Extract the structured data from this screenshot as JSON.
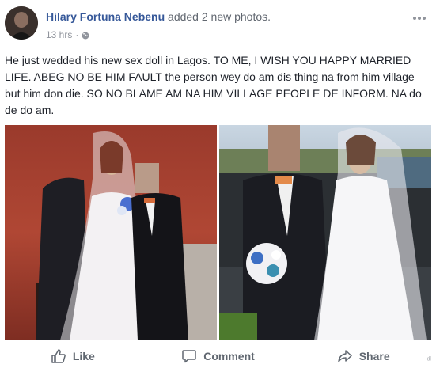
{
  "post": {
    "author": "Hilary Fortuna Nebenu",
    "action": "added 2 new photos.",
    "time": "13 hrs",
    "separator": "·",
    "more_icon": "ellipsis-icon",
    "privacy_icon": "globe-icon",
    "text": "He just wedded his new sex doll in Lagos. TO ME, I WISH YOU HAPPY MARRIED LIFE. ABEG NO BE HIM FAULT the person wey do am dis thing na from him village but him don die. SO NO BLAME AM NA HIM VILLAGE PEOPLE DE INFORM. NA do de do am."
  },
  "actions": {
    "like": "Like",
    "comment": "Comment",
    "share": "Share"
  },
  "corner_mark": "ᵈˡ"
}
